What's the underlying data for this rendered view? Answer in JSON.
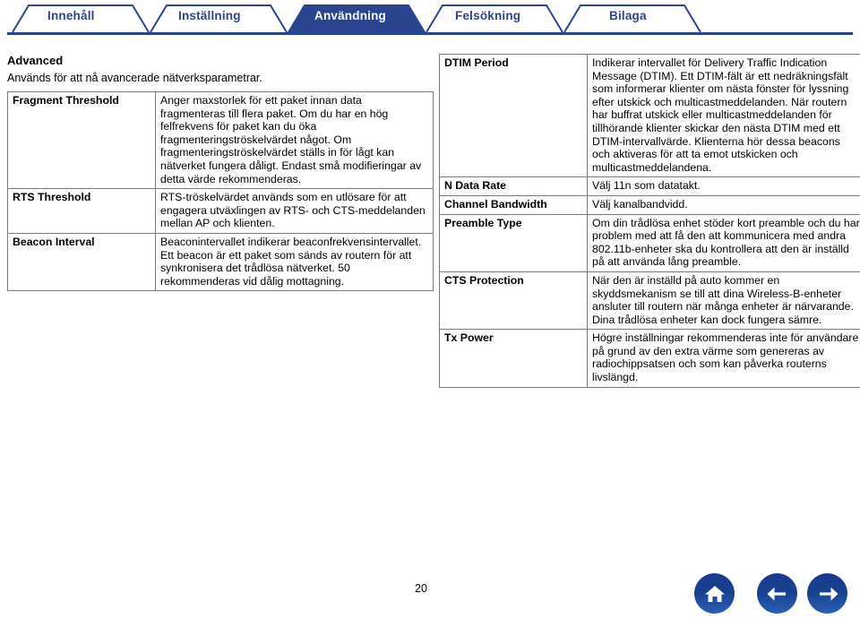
{
  "tabs": [
    {
      "label": "Innehåll",
      "active": false
    },
    {
      "label": "Inställning",
      "active": false
    },
    {
      "label": "Användning",
      "active": true
    },
    {
      "label": "Felsökning",
      "active": false
    },
    {
      "label": "Bilaga",
      "active": false
    }
  ],
  "colors": {
    "brand_blue": "#2b4490",
    "active_tab_bg": "#2a4490",
    "active_tab_text": "#ffffff",
    "table_border": "#7a7a7a",
    "page_bg": "#ffffff",
    "nav_button": "#1b3a8c"
  },
  "left": {
    "title": "Advanced",
    "description": "Används för att nå avancerade nätverksparametrar.",
    "rows": [
      {
        "key": "Fragment Threshold",
        "value": "Anger maxstorlek för ett paket innan data fragmenteras till flera paket. Om du har en hög felfrekvens för paket kan du öka fragmenteringströskelvärdet något. Om fragmenteringströskelvärdet ställs in för lågt kan nätverket fungera dåligt. Endast små modifieringar av detta värde rekommenderas."
      },
      {
        "key": "RTS Threshold",
        "value": "RTS-tröskelvärdet används som en utlösare för att engagera utväxlingen av RTS- och CTS-meddelanden mellan AP och klienten."
      },
      {
        "key": "Beacon Interval",
        "value": "Beaconintervallet indikerar beaconfrekvensintervallet. Ett beacon är ett paket som sänds av routern för att synkronisera det trådlösa nätverket. 50 rekommenderas vid dålig mottagning."
      }
    ]
  },
  "right": {
    "rows": [
      {
        "key": "DTIM Period",
        "value": "Indikerar intervallet för Delivery Traffic Indication Message (DTIM). Ett DTIM-fält är ett nedräkningsfält som informerar klienter om nästa fönster för lyssning efter utskick och multicastmeddelanden. När routern har buffrat utskick eller multicastmeddelanden för tillhörande klienter skickar den nästa DTIM med ett DTIM-intervallvärde. Klienterna hör dessa beacons och aktiveras för att ta emot utskicken och multicastmeddelandena."
      },
      {
        "key": "N Data Rate",
        "value": "Välj 11n som datatakt."
      },
      {
        "key": "Channel Bandwidth",
        "value": "Välj kanalbandvidd."
      },
      {
        "key": "Preamble Type",
        "value": "Om din trådlösa enhet stöder kort preamble och du har problem med att få den att kommunicera med andra 802.11b-enheter ska du kontrollera att den är inställd på att använda lång preamble."
      },
      {
        "key": "CTS Protection",
        "value": "När den är inställd på auto kommer en skyddsmekanism se till att dina Wireless-B-enheter ansluter till routern när många enheter är närvarande. Dina trådlösa enheter kan dock fungera sämre."
      },
      {
        "key": "Tx Power",
        "value": "Högre inställningar rekommenderas inte för användare på grund av den extra värme som genereras av radiochippsatsen och som kan påverka routerns livslängd."
      }
    ]
  },
  "footer": {
    "page_number": "20",
    "buttons": [
      {
        "name": "home-button",
        "icon": "home-icon"
      },
      {
        "name": "back-button",
        "icon": "arrow-left-icon"
      },
      {
        "name": "forward-button",
        "icon": "arrow-right-icon"
      }
    ]
  }
}
